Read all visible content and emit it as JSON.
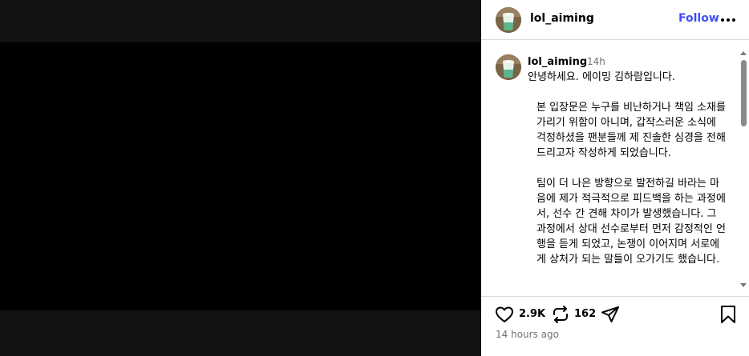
{
  "post": {
    "username": "lol_aiming",
    "follow_label": "Follow",
    "more_icon": "more-horizontal-icon"
  },
  "caption": {
    "username": "lol_aiming",
    "time": "14h",
    "greeting": "안녕하세요. 에이밍 김하람입니다.",
    "paragraph_1": "본 입장문은 누구를 비난하거나 책임 소재를 가리기 위함이 아니며, 갑작스러운 소식에 걱정하셨을 팬분들께 제 진솔한 심경을 전해드리고자 작성하게 되었습니다.",
    "paragraph_2": "팀이 더 나은 방향으로 발전하길 바라는 마음에 제가 적극적으로 피드백을 하는 과정에서, 선수 간 견해 차이가 발생했습니다. 그 과정에서 상대 선수로부터 먼저 감정적인 언행을 듣게 되었고, 논쟁이 이어지며 서로에게 상처가 되는 말들이 오가기도 했습니다."
  },
  "actions": {
    "like_count": "2.9K",
    "repost_count": "162"
  },
  "timestamp": "14 hours ago",
  "icons": [
    "heart-icon",
    "repost-icon",
    "share-icon",
    "bookmark-icon",
    "more-horizontal-icon"
  ],
  "colors": {
    "follow": "#4150f7",
    "muted": "#737373",
    "media_bg": "#121212"
  }
}
